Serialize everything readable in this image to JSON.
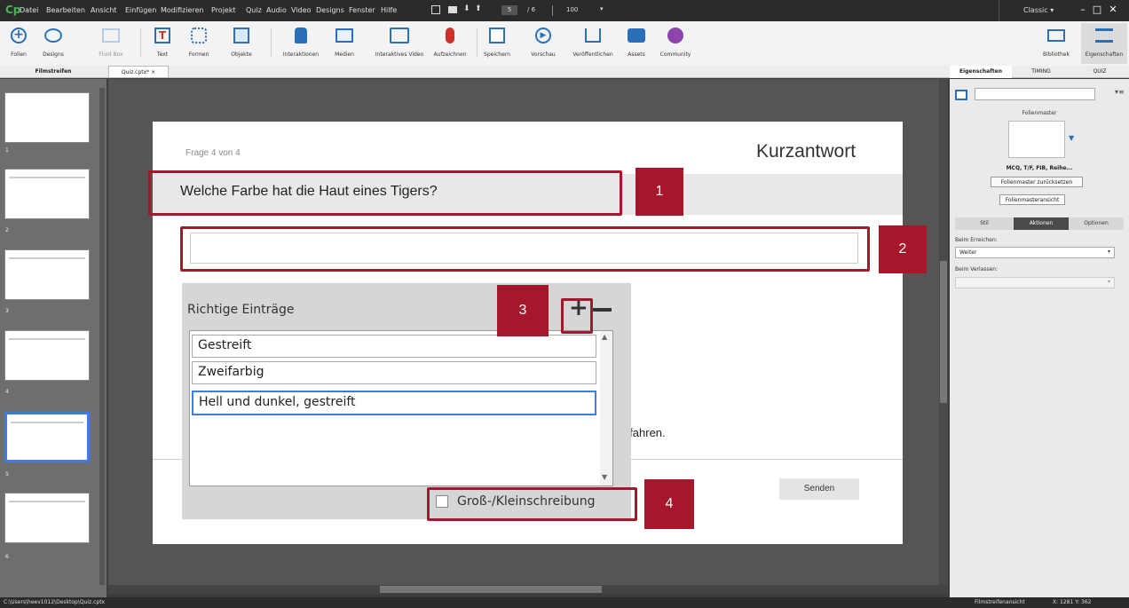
{
  "app": {
    "logo": "Cp"
  },
  "menu": [
    "Datei",
    "Bearbeiten",
    "Ansicht",
    "Einfügen",
    "Modifizieren",
    "Projekt",
    "Quiz",
    "Audio",
    "Video",
    "Designs",
    "Fenster",
    "Hilfe"
  ],
  "nav": {
    "current": "5",
    "sep": "/ 6",
    "zoom": "100"
  },
  "workspace_mode": "Classic",
  "toolbar": [
    "Folien",
    "Designs",
    "Fluid Box",
    "Text",
    "Formen",
    "Objekte",
    "Interaktionen",
    "Medien",
    "Interaktives Video",
    "Aufzeichnen",
    "Speichern",
    "Vorschau",
    "Veröffentlichen",
    "Assets",
    "Community"
  ],
  "toolbar_right": [
    "Bibliothek",
    "Eigenschaften"
  ],
  "tabs": {
    "filmstrip": "Filmstreifen",
    "doc": "Quiz.cptx*",
    "close": "×"
  },
  "rtabs": [
    "Eigenschaften",
    "TIMING",
    "QUIZ"
  ],
  "slides": [
    "1",
    "2",
    "3",
    "4",
    "5",
    "6"
  ],
  "slide": {
    "counter": "Frage 4 von 4",
    "title": "Kurzantwort",
    "question": "Welche Farbe hat die Haut eines Tigers?",
    "partial": "ortfahren.",
    "submit": "Senden"
  },
  "popup": {
    "title": "Richtige Einträge",
    "entries": [
      "Gestreift",
      "Zweifarbig",
      "Hell und dunkel, gestreift"
    ],
    "checkbox": "Groß-/Kleinschreibung"
  },
  "callouts": [
    "1",
    "2",
    "3",
    "4"
  ],
  "rpanel": {
    "master_label": "Folienmaster",
    "master_name": "MCQ, T/F, FIB, Reihe...",
    "reset_btn": "Folienmaster zurücksetzen",
    "view_btn": "Folienmasteransicht",
    "subtabs": [
      "Stil",
      "Aktionen",
      "Optionen"
    ],
    "on_enter_label": "Beim Erreichen:",
    "on_enter_value": "Weiter",
    "on_exit_label": "Beim Verlassen:"
  },
  "status": {
    "path": "C:\\Users\\heev1012\\Desktop\\Quiz.cptx",
    "view": "Filmstreifenansicht",
    "coords": "X: 1281 Y: 362"
  },
  "colors": {
    "accent": "#a6172c",
    "selection": "#3d7ed8"
  }
}
